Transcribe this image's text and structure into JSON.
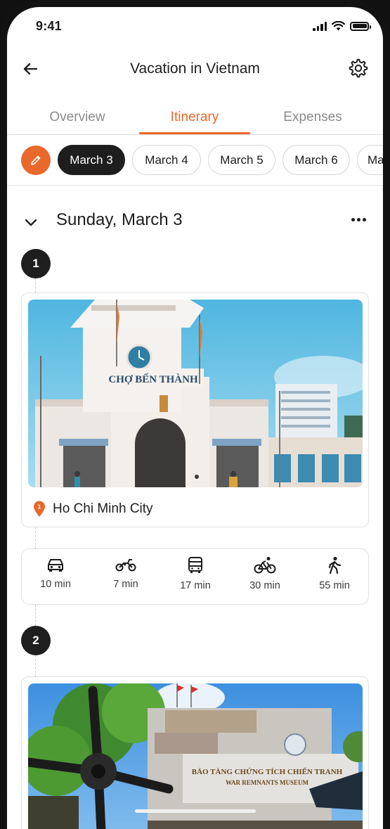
{
  "status_bar": {
    "time": "9:41"
  },
  "header": {
    "title": "Vacation in Vietnam"
  },
  "tabs": [
    {
      "label": "Overview"
    },
    {
      "label": "Itinerary"
    },
    {
      "label": "Expenses"
    }
  ],
  "active_tab": "Itinerary",
  "dates": [
    {
      "label": "March 3"
    },
    {
      "label": "March 4"
    },
    {
      "label": "March 5"
    },
    {
      "label": "March 6"
    },
    {
      "label": "Ma"
    }
  ],
  "selected_date": "March 3",
  "day": {
    "title": "Sunday, March 3"
  },
  "stops": [
    {
      "number": "1",
      "pin_number": "1",
      "name": "Ho Chi Minh City",
      "photo_sign": "CHỢ BẾN THÀNH"
    },
    {
      "number": "2",
      "photo_sign_line1": "BẢO TÀNG CHỨNG TÍCH CHIẾN TRANH",
      "photo_sign_line2": "WAR REMNANTS MUSEUM"
    }
  ],
  "transport": [
    {
      "icon": "car-icon",
      "label": "10 min"
    },
    {
      "icon": "motorbike-icon",
      "label": "7 min"
    },
    {
      "icon": "bus-icon",
      "label": "17 min"
    },
    {
      "icon": "bicycle-icon",
      "label": "30 min"
    },
    {
      "icon": "walk-icon",
      "label": "55 min"
    }
  ],
  "colors": {
    "accent": "#e8692b",
    "dark": "#1e1e1e",
    "muted": "#8a8a8a"
  }
}
